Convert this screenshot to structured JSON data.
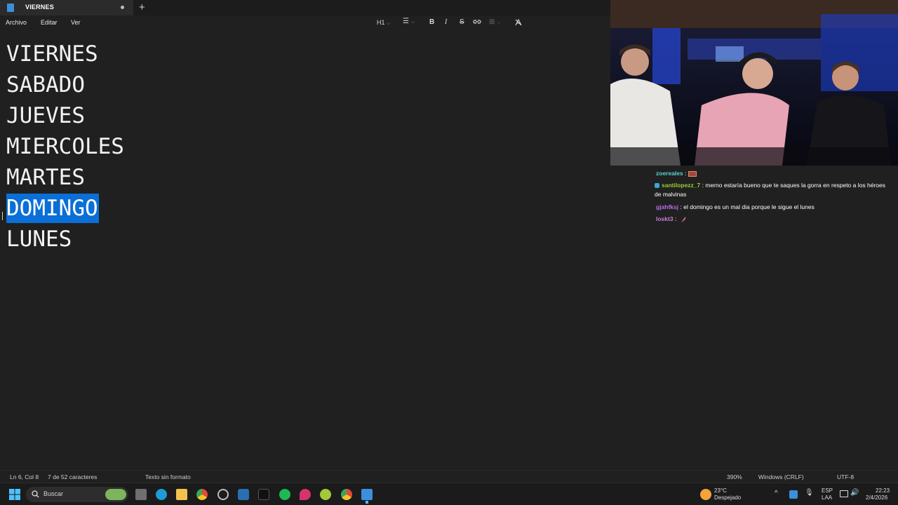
{
  "window": {
    "tab_title": "VIERNES",
    "new_tab_symbol": "+"
  },
  "menu": {
    "items": [
      "Archivo",
      "Editar",
      "Ver"
    ]
  },
  "toolbar": {
    "heading_label": "H1",
    "bold_label": "B",
    "italic_label": "I",
    "strike_label": "S"
  },
  "editor": {
    "lines": [
      "VIERNES",
      "SABADO",
      "JUEVES",
      "MIERCOLES",
      "MARTES",
      "DOMINGO",
      "LUNES"
    ],
    "selected_line_index": 5,
    "selection_color": "#0a6fd6"
  },
  "status": {
    "position": "Ln 6, Col 8",
    "selection_count": "7 de 52 caracteres",
    "format": "Texto sin formato",
    "zoom": "390%",
    "line_ending": "Windows (CRLF)",
    "encoding": "UTF-8"
  },
  "chat": {
    "messages": [
      {
        "user": "zoereales",
        "text": "",
        "color": "#5ad1d1",
        "emote": "box"
      },
      {
        "user": "santilopezz_7",
        "text": "merno estaría bueno que te saques la gorra en respeto a los héroes de malvinas",
        "color": "#9acd32",
        "badge": true
      },
      {
        "user": "gjahfksj",
        "text": "el domingo es un mal dia porque le sigue el lunes",
        "color": "#b46fe6"
      },
      {
        "user": "loskt3",
        "text": "",
        "color": "#c77ed8",
        "emote": "feather"
      }
    ]
  },
  "taskbar": {
    "search_label": "Buscar",
    "weather_temp": "23°C",
    "weather_desc": "Despejado",
    "lang_top": "ESP",
    "lang_bottom": "LAA",
    "time": "22:23",
    "date": "2/4/2026"
  }
}
